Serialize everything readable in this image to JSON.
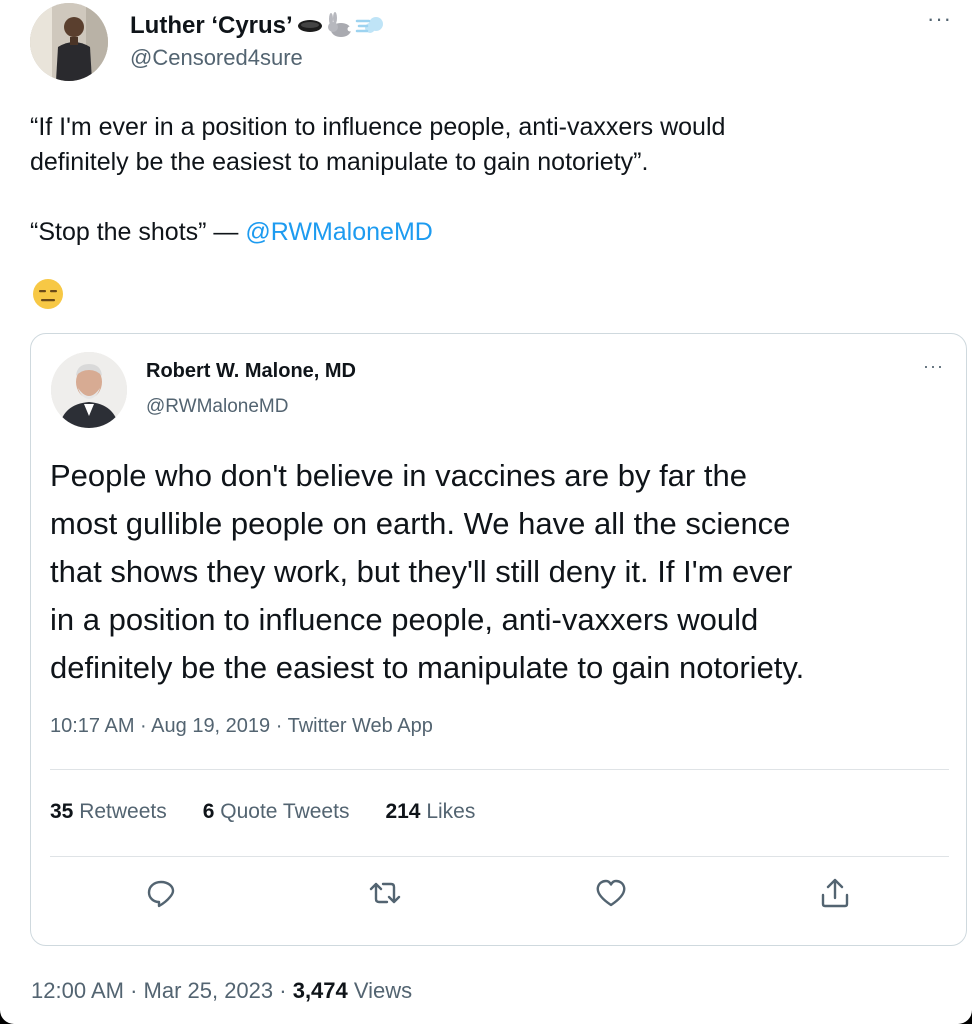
{
  "author": {
    "name": "Luther ‘Cyrus’",
    "handle": "@Censored4sure",
    "name_emojis": [
      "hole-emoji",
      "rabbit-emoji",
      "dash-emoji"
    ]
  },
  "tweet": {
    "lines": [
      "“If I'm ever in a position to influence people, anti-vaxxers would",
      "definitely be the easiest to manipulate to gain notoriety”."
    ],
    "quote_line_prefix": "“Stop the shots”  — ",
    "mention": "@RWMaloneMD",
    "trailing_emoji": "expressionless-face-emoji"
  },
  "quoted": {
    "name": "Robert W. Malone, MD",
    "handle": "@RWMaloneMD",
    "lines": [
      "People who don't believe in vaccines are by far the",
      "most gullible people on earth. We have all the science",
      "that shows they work, but they'll still deny it. If I'm ever",
      "in a position to influence people, anti-vaxxers would",
      "definitely be the easiest to manipulate to gain notoriety."
    ],
    "meta": "10:17 AM · Aug 19, 2019 · Twitter Web App",
    "retweets_count": "35",
    "retweets_label": " Retweets",
    "quotes_count": "6",
    "quotes_label": " Quote Tweets",
    "likes_count": "214",
    "likes_label": " Likes",
    "actions": [
      "reply-icon",
      "retweet-icon",
      "like-icon",
      "share-icon"
    ]
  },
  "footer": {
    "time_date": "12:00 AM · Mar 25, 2023 · ",
    "views_count": "3,474",
    "views_label": " Views"
  },
  "more_label": "···",
  "colors": {
    "link": "#1d9bf0",
    "text": "#0f1419",
    "muted": "#536471",
    "border": "#cfd9de"
  }
}
